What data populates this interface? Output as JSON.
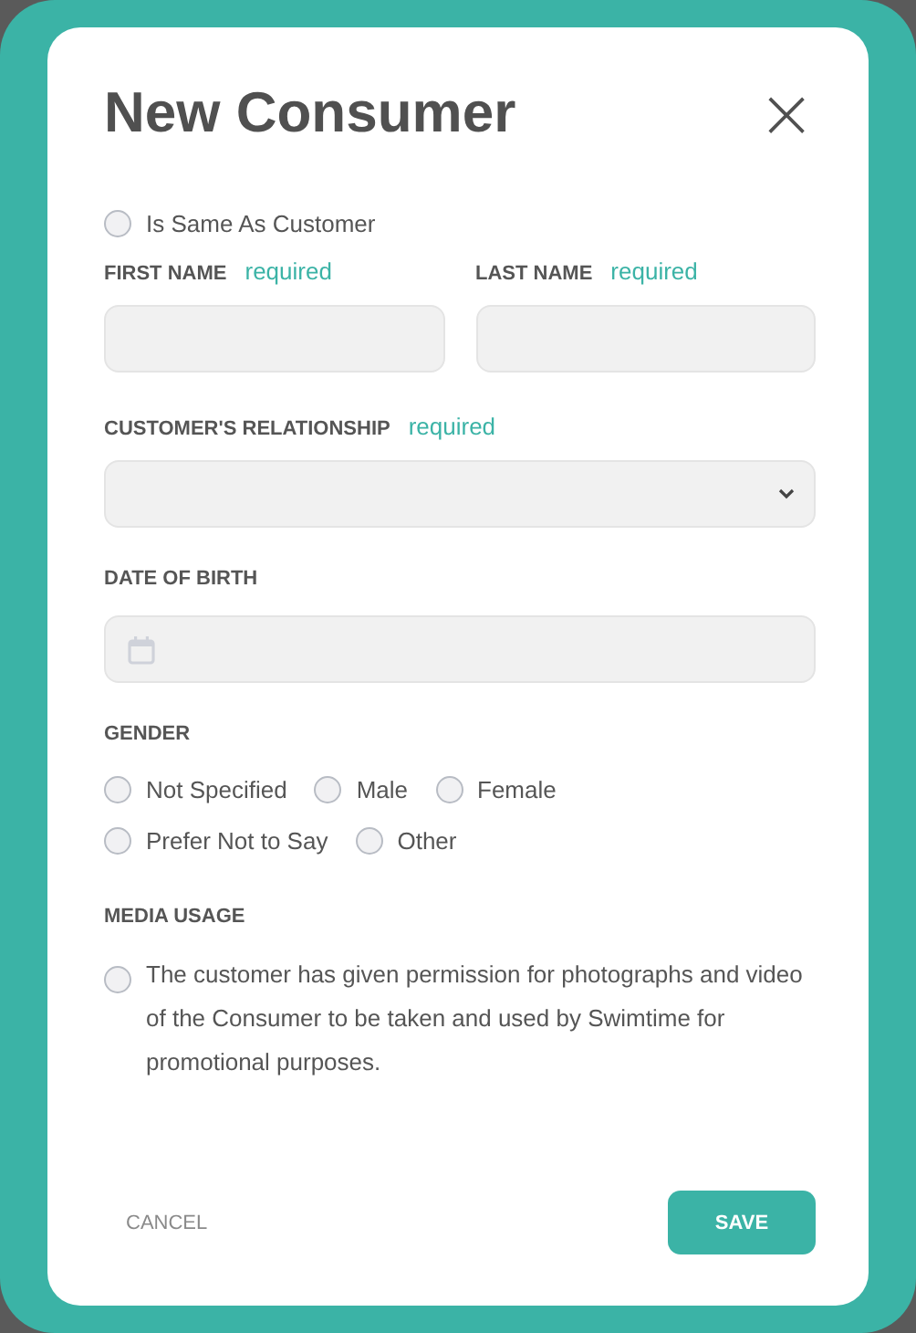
{
  "dialog": {
    "title": "New Consumer",
    "close_label": "×"
  },
  "same_as_customer": {
    "label": "Is Same As Customer",
    "checked": false
  },
  "first_name": {
    "label": "FIRST NAME",
    "hint": "required"
  },
  "last_name": {
    "label": "LAST NAME",
    "hint": "required"
  },
  "relationship": {
    "label": "CUSTOMER'S RELATIONSHIP",
    "hint": "required"
  },
  "date_of_birth": {
    "label": "DATE OF BIRTH"
  },
  "gender": {
    "label": "GENDER",
    "options": [
      {
        "label": "Not Specified",
        "selected": false
      },
      {
        "label": "Male",
        "selected": false
      },
      {
        "label": "Female",
        "selected": false
      },
      {
        "label": "Prefer Not to Say",
        "selected": false
      },
      {
        "label": "Other",
        "selected": false
      }
    ]
  },
  "media_usage": {
    "label": "MEDIA USAGE",
    "text": "The customer has given permission for photographs and video of the Consumer to be taken and used by Swimtime for promotional purposes.",
    "checked": false
  },
  "buttons": {
    "cancel": "CANCEL",
    "save": "SAVE"
  }
}
